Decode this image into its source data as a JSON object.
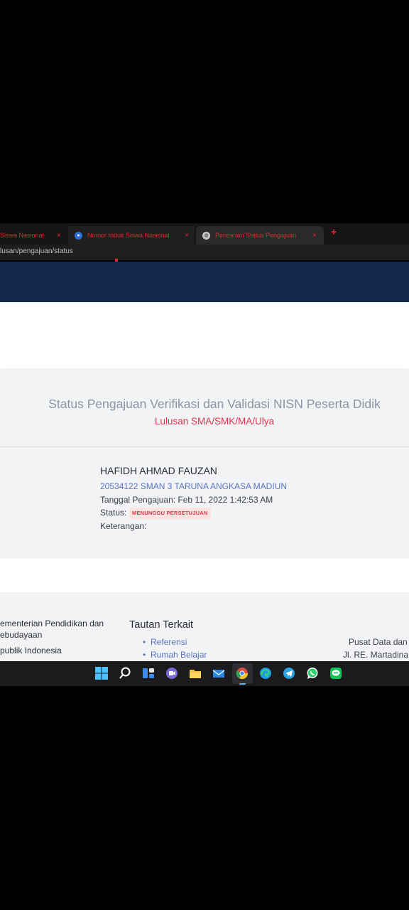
{
  "browser": {
    "tabs": [
      {
        "label": "Siswa Nasional",
        "close": "×"
      },
      {
        "label": "Nomor Induk Siswa Nasional",
        "close": "×"
      },
      {
        "label": "Pencarian Status Pengajuan",
        "close": "×"
      }
    ],
    "new_tab": "+",
    "url": "lusan/pengajuan/status"
  },
  "main": {
    "title": "Status Pengajuan Verifikasi dan Validasi NISN Peserta Didik",
    "subtitle": "Lulusan SMA/SMK/MA/Ulya",
    "student": {
      "name": "HAFIDH AHMAD FAUZAN",
      "school": "20534122 SMAN 3 TARUNA ANGKASA MADIUN",
      "tanggal": "Tanggal Pengajuan: Feb 11, 2022 1:42:53 AM",
      "status_label": "Status:",
      "status_badge": "MENUNGGU PERSETUJUAN",
      "keterangan": "Keterangan:"
    }
  },
  "footer": {
    "org_line1": "ementerian Pendidikan dan",
    "org_line2": "ebudayaan",
    "org_line3": "publik Indonesia",
    "links_title": "Tautan Terkait",
    "links": [
      "Referensi",
      "Rumah Belajar"
    ],
    "address_line1": "Pusat Data dan",
    "address_line2": "Jl. RE. Martadina"
  },
  "taskbar": {
    "icons": [
      "windows-start-icon",
      "search-icon",
      "widgets-icon",
      "teams-chat-icon",
      "file-explorer-icon",
      "mail-icon",
      "chrome-icon",
      "edge-icon",
      "telegram-icon",
      "whatsapp-icon",
      "line-icon"
    ]
  },
  "colors": {
    "accent_red": "#e8242f",
    "header_navy": "#17294a",
    "link_blue": "#5b74c4",
    "badge_bg": "#fde2df",
    "badge_text": "#e0344e"
  }
}
